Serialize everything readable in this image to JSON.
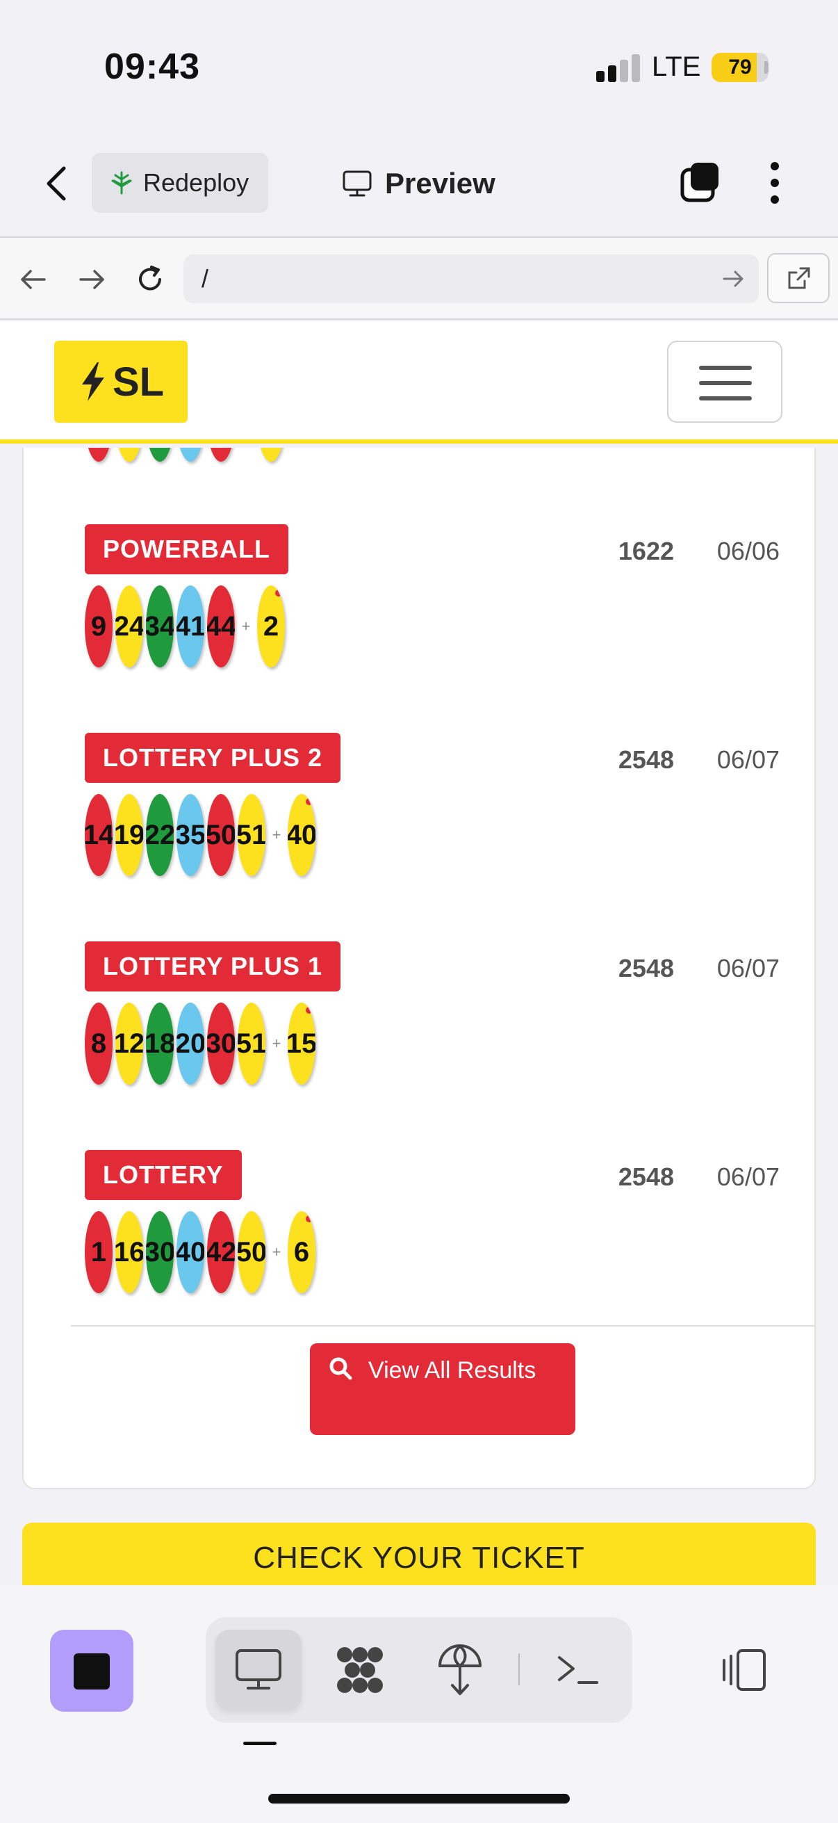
{
  "status_bar": {
    "time": "09:43",
    "network": "LTE",
    "battery": "79",
    "battery_level": 0.79
  },
  "app_toolbar": {
    "redeploy_label": "Redeploy",
    "preview_label": "Preview"
  },
  "browser": {
    "url": "/"
  },
  "site": {
    "logo_text": "SL"
  },
  "results": [
    {
      "game": "POWERBALL",
      "draw": "1622",
      "date": "06/06",
      "balls": [
        {
          "n": "9",
          "color": "red"
        },
        {
          "n": "24",
          "color": "yellow"
        },
        {
          "n": "34",
          "color": "green"
        },
        {
          "n": "41",
          "color": "blue"
        },
        {
          "n": "44",
          "color": "red"
        }
      ],
      "bonus": "2"
    },
    {
      "game": "LOTTERY PLUS 2",
      "draw": "2548",
      "date": "06/07",
      "balls": [
        {
          "n": "14",
          "color": "red"
        },
        {
          "n": "19",
          "color": "yellow"
        },
        {
          "n": "22",
          "color": "green"
        },
        {
          "n": "35",
          "color": "blue"
        },
        {
          "n": "50",
          "color": "red"
        },
        {
          "n": "51",
          "color": "yellow"
        }
      ],
      "bonus": "40"
    },
    {
      "game": "LOTTERY PLUS 1",
      "draw": "2548",
      "date": "06/07",
      "balls": [
        {
          "n": "8",
          "color": "red"
        },
        {
          "n": "12",
          "color": "yellow"
        },
        {
          "n": "18",
          "color": "green"
        },
        {
          "n": "20",
          "color": "blue"
        },
        {
          "n": "30",
          "color": "red"
        },
        {
          "n": "51",
          "color": "yellow"
        }
      ],
      "bonus": "15"
    },
    {
      "game": "LOTTERY",
      "draw": "2548",
      "date": "06/07",
      "balls": [
        {
          "n": "1",
          "color": "red"
        },
        {
          "n": "16",
          "color": "yellow"
        },
        {
          "n": "30",
          "color": "green"
        },
        {
          "n": "40",
          "color": "blue"
        },
        {
          "n": "42",
          "color": "red"
        },
        {
          "n": "50",
          "color": "yellow"
        }
      ],
      "bonus": "6"
    }
  ],
  "view_all_label": "View All Results",
  "check_ticket_label": "CHECK YOUR TICKET",
  "colors": {
    "brand_yellow": "#fde11e",
    "brand_red": "#e22b36",
    "ball_green": "#1f9a3c",
    "ball_blue": "#6ac7ee"
  }
}
